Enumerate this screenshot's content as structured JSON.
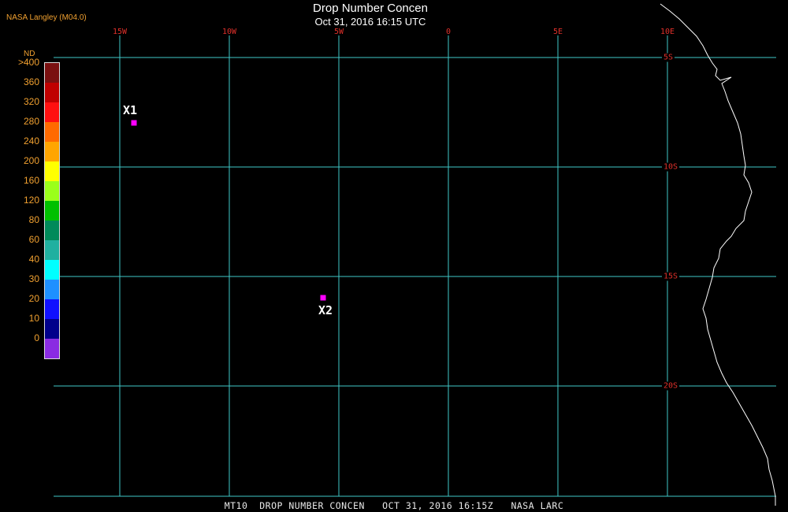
{
  "header": {
    "credit": "NASA Langley (M04.0)",
    "title": "Drop Number Concen",
    "subtitle": "Oct 31, 2016 16:15 UTC"
  },
  "footer": {
    "caption": "MT10  DROP NUMBER CONCEN   OCT 31, 2016 16:15Z   NASA LARC"
  },
  "legend": {
    "title": "ND",
    "labels": [
      ">400",
      "360",
      "320",
      "280",
      "240",
      "200",
      "160",
      "120",
      "80",
      "60",
      "40",
      "30",
      "20",
      "10",
      "0"
    ],
    "colors": [
      "#7a1010",
      "#c00000",
      "#ff1010",
      "#ff6a00",
      "#ffa500",
      "#ffff00",
      "#9aff1a",
      "#00c000",
      "#008a5a",
      "#20b0a0",
      "#00ffff",
      "#1e90ff",
      "#1010ff",
      "#00008b",
      "#8a2be2"
    ]
  },
  "grid": {
    "lon_labels": [
      "15W",
      "10W",
      "5W",
      "0",
      "5E",
      "10E"
    ],
    "lat_labels": [
      "5S",
      "10S",
      "15S",
      "20S"
    ],
    "line_color": "#40c8c8",
    "label_color": "#e0302a"
  },
  "markers": [
    {
      "label": "X1",
      "color": "#ff00ff"
    },
    {
      "label": "X2",
      "color": "#ff00ff"
    }
  ],
  "coastline_color": "#ffffff"
}
